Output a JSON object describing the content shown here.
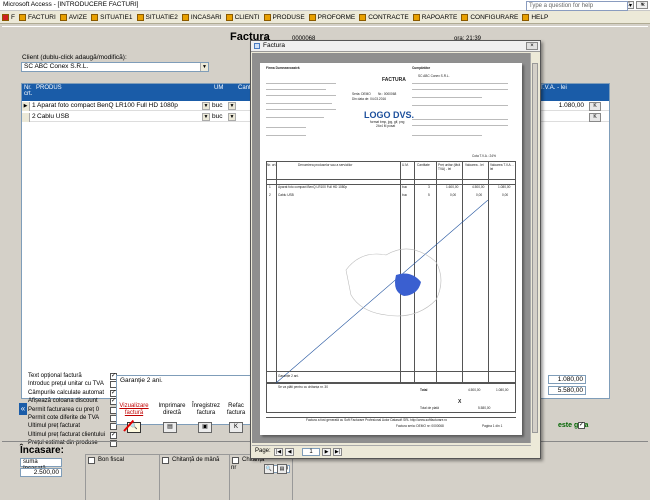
{
  "window": {
    "title": "Microsoft Access - [INTRODUCERE FACTURI]"
  },
  "menu": [
    {
      "label": "F",
      "name": "f"
    },
    {
      "label": "FACTURI",
      "name": "facturi"
    },
    {
      "label": "AVIZE",
      "name": "avize"
    },
    {
      "label": "SITUATIE1",
      "name": "situatie1"
    },
    {
      "label": "SITUATIE2",
      "name": "situatie2"
    },
    {
      "label": "INCASARI",
      "name": "incasari"
    },
    {
      "label": "CLIENTI",
      "name": "clienti"
    },
    {
      "label": "PRODUSE",
      "name": "produse"
    },
    {
      "label": "PROFORME",
      "name": "proforme"
    },
    {
      "label": "CONTRACTE",
      "name": "contracte"
    },
    {
      "label": "RAPOARTE",
      "name": "rapoarte"
    },
    {
      "label": "CONFIGURARE",
      "name": "configurare"
    },
    {
      "label": "HELP",
      "name": "help"
    }
  ],
  "help_placeholder": "Type a question for help",
  "header": {
    "title": "Factura",
    "nr_label": "nr.",
    "nr_value": "0000068",
    "ora": "ora: 21:39"
  },
  "client": {
    "label": "Client (dublu-click adaugă/modifică):",
    "value": "SC ABC Conex S.R.L."
  },
  "grid": {
    "headers": {
      "nr": "Nr. crt.",
      "produs": "PRODUS",
      "um": "UM",
      "cant": "Cant",
      "tva": "T.V.A. - lei"
    },
    "rows": [
      {
        "nr": "1",
        "produs": "Aparat foto compact BenQ LR100 Full HD 1080p",
        "um": "buc",
        "value": "1.080,00"
      },
      {
        "nr": "2",
        "produs": "Cablu USB",
        "um": "buc",
        "value": ""
      }
    ]
  },
  "options": [
    {
      "label": "Text opțional factură",
      "checked": true
    },
    {
      "label": "Introduc prețul unitar cu TVA",
      "checked": false
    },
    {
      "label": "Câmpurile calculate automat",
      "checked": true
    },
    {
      "label": "Afișează coloana discount",
      "checked": true
    },
    {
      "label": "Permit facturarea cu preț 0",
      "checked": false
    },
    {
      "label": "Permit cote diferite de TVA",
      "checked": false
    },
    {
      "label": "Ultimul preț facturat",
      "checked": false
    },
    {
      "label": "Ultimul preț facturat clientului",
      "checked": true
    },
    {
      "label": "Prețul estimat din produse",
      "checked": false
    }
  ],
  "optional_text": "Garanție 2 ani.",
  "actions": [
    {
      "label": "Vizualizare factură",
      "name": "vizualizare",
      "icon": "magnifier-icon"
    },
    {
      "label": "Imprimare directă",
      "name": "imprimare",
      "icon": "printer-icon"
    },
    {
      "label": "Înregistrez factura",
      "name": "inregistrez",
      "icon": "save-icon"
    },
    {
      "label": "Refac factura",
      "name": "refac",
      "icon": "undo-icon"
    }
  ],
  "totals": {
    "tva": "1.080,00",
    "total": "5.580,00"
  },
  "este_label": "este gata",
  "incasare": {
    "title": "Încasare:",
    "sum_label": "suma încasată",
    "sum_value": "2.500,00",
    "boxes": [
      {
        "label": "Bon fiscal"
      },
      {
        "label": "Chitanță de mână"
      },
      {
        "label": "Chitanță",
        "nr_label": "nr",
        "nr_value": "30"
      }
    ]
  },
  "preview": {
    "title": "Factura",
    "page_label": "Page:",
    "page_value": "1",
    "doc": {
      "furnizor_label": "Firma Dumneavoastră",
      "cumparator_label": "Cumpărător",
      "cumparator_name": "SC ABC Conex S.R.L.",
      "invoice_title": "FACTURA",
      "seria": "Seria: DEMO",
      "nr": "Nr.: 0000068",
      "data": "Din data de: 04.03.2016",
      "logo": "LOGO DVS.",
      "logo_sub1": "format bmp, jpg, gif, png",
      "logo_sub2": "24x4 M posat",
      "cota_tva": "Cota T.V.A.: 24%",
      "table_headers": [
        "Nr. crt.",
        "Denumirea produselor sau a serviciilor",
        "U.M.",
        "Cantitate",
        "Preț unitar (fără TVA) - lei",
        "Valoarea - lei",
        "Valoarea T.V.A. - lei"
      ],
      "rows": [
        {
          "nr": "1",
          "name": "Aparat foto compact BenQ LR100 Full HD 1080p",
          "um": "buc",
          "cant": "3",
          "pu": "1.600,00",
          "val": "4.500,00",
          "tva": "1.080,00"
        },
        {
          "nr": "2",
          "name": "Cablu USB",
          "um": "buc",
          "cant": "5",
          "pu": "0,00",
          "val": "0,00",
          "tva": "0,00"
        }
      ],
      "garantie": "Garanție 2 ani.",
      "nota1": "Se va plăti pentru cu chitanța nr. 30",
      "total_label": "Total",
      "total_val": "4.500,00",
      "total_tva": "1.080,00",
      "total_plata_label": "Total de plată",
      "total_plata": "5.580,00",
      "footer": "Factura a fost generată cu Soft Facturare Profesional Autor Datasoft SRL http://www.softfacturare.ro",
      "footer_seria": "Factura seria: DEMO  nr: 0000068",
      "footer_page": "Pagina 1 din 1"
    }
  }
}
